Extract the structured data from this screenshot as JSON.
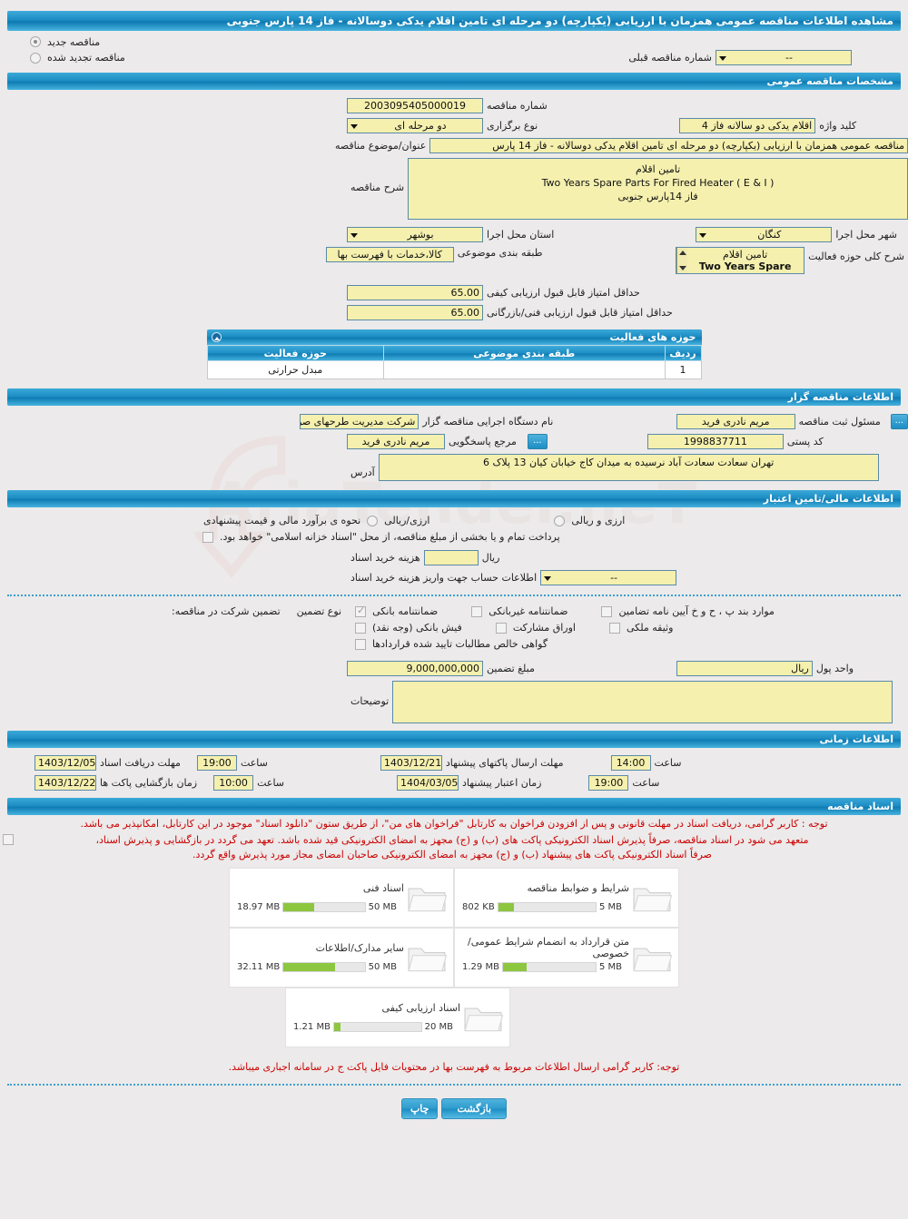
{
  "header": {
    "title": "مشاهده اطلاعات مناقصه عمومی همزمان با ارزیابی (یکپارچه) دو مرحله ای تامین اقلام یدکی دوسالانه - فاز 14 پارس جنوبی"
  },
  "top_options": {
    "new_tender_label": "مناقصه جدید",
    "renewed_tender_label": "مناقصه تجدید شده",
    "new_tender_selected": true,
    "renewed_tender_selected": false,
    "previous_number_label": "شماره مناقصه قبلی",
    "previous_number_value": "--"
  },
  "general": {
    "section_title": "مشخصات مناقصه عمومی",
    "tender_number_label": "شماره مناقصه",
    "tender_number_value": "2003095405000019",
    "holding_type_label": "نوع برگزاری",
    "holding_type_value": "دو مرحله ای",
    "keyword_label": "کلید واژه",
    "keyword_value": "اقلام یدکی دو سالانه فاز 4",
    "subject_label": "عنوان/موضوع مناقصه",
    "subject_value": "مناقصه عمومی همزمان با ارزیابی (یکپارچه) دو مرحله ای تامین اقلام یدکی دوسالانه  - فاز 14 پارس",
    "description_label": "شرح مناقصه",
    "description_line1": "تامین اقلام",
    "description_line2": "Two Years Spare Parts For Fired Heater ( E & I )",
    "description_line3": "فاز 14پارس جنوبی",
    "province_label": "استان محل اجرا",
    "province_value": "بوشهر",
    "city_label": "شهر محل اجرا",
    "city_value": "کنگان",
    "classification_label": "طبقه بندی موضوعی",
    "classification_value": "کالا،خدمات با فهرست بها",
    "activity_scope_label": "شرح کلی حوزه فعالیت",
    "activity_scope_line1": "تامین اقلام",
    "activity_scope_line2": "Two Years Spare Parts",
    "min_qualitative_label": "حداقل امتیاز قابل قبول ارزیابی کیفی",
    "min_qualitative_value": "65.00",
    "min_technical_label": "حداقل امتیاز قابل قبول ارزیابی فنی/بازرگانی",
    "min_technical_value": "65.00"
  },
  "activity_table": {
    "title": "حوزه های فعالیت",
    "columns": [
      "ردیف",
      "طبقه بندی موضوعی",
      "حوزه فعالیت"
    ],
    "rows": [
      {
        "no": "1",
        "classification": "",
        "activity": "مبدل حرارتی"
      }
    ]
  },
  "organizer": {
    "section_title": "اطلاعات مناقصه گزار",
    "executive_body_label": "نام دستگاه اجرایی مناقصه گزار",
    "executive_body_value": "شرکت مدیریت طرحهای صن",
    "registrar_label": "مسئول ثبت مناقصه",
    "registrar_value": "مریم نادری فرید",
    "contact_label": "مرجع پاسخگویی",
    "contact_value": "مریم نادری فرید",
    "postal_code_label": "کد پستی",
    "postal_code_value": "1998837711",
    "address_label": "آدرس",
    "address_value": "تهران سعادت سعادت آباد نرسیده به میدان کاج خیابان کیان 13 پلاک 6",
    "dots_label": "..."
  },
  "financial": {
    "section_title": "اطلاعات مالی/تامین اعتبار",
    "estimate_label": "نحوه ی برآورد مالی و قیمت پیشنهادی",
    "option_rial_label": "ارزی/ریالی",
    "option_rial_selected": false,
    "option_currency_rial_label": "ارزی و ریالی",
    "option_currency_rial_selected": false,
    "treasury_note": "پرداخت تمام و یا بخشی از مبلغ مناقصه، از محل \"اسناد خزانه اسلامی\" خواهد بود.",
    "treasury_checked": false,
    "doc_cost_label": "هزینه خرید اسناد",
    "doc_cost_value": "",
    "doc_cost_currency": "ریال",
    "account_info_label": "اطلاعات حساب جهت واریز هزینه خرید اسناد",
    "account_info_value": "--"
  },
  "guarantee": {
    "participation_label": "تضمین شرکت در مناقصه:",
    "type_label": "نوع تضمین",
    "options": [
      {
        "label": "ضمانتنامه بانکی",
        "checked": true
      },
      {
        "label": "ضمانتنامه غیربانکی",
        "checked": false
      },
      {
        "label": "موارد بند پ ، ح و خ آیین نامه تضامین",
        "checked": false
      },
      {
        "label": "فیش بانکی (وجه نقد)",
        "checked": false
      },
      {
        "label": "اوراق مشارکت",
        "checked": false
      },
      {
        "label": "وثیقه ملکی",
        "checked": false
      },
      {
        "label": "گواهی خالص مطالبات تایید شده قراردادها",
        "checked": false
      }
    ],
    "amount_label": "مبلغ تضمین",
    "amount_value": "9,000,000,000",
    "currency_unit_label": "واحد پول",
    "currency_unit_value": "ریال",
    "notes_label": "توضیحات",
    "notes_value": ""
  },
  "timing": {
    "section_title": "اطلاعات زمانی",
    "doc_receive_label": "مهلت دریافت اسناد",
    "doc_receive_date": "1403/12/05",
    "doc_receive_time_label": "ساعت",
    "doc_receive_time": "19:00",
    "envelope_submit_label": "مهلت ارسال پاکتهای پیشنهاد",
    "envelope_submit_date": "1403/12/21",
    "envelope_submit_time_label": "ساعت",
    "envelope_submit_time": "14:00",
    "envelope_open_label": "زمان بازگشایی پاکت ها",
    "envelope_open_date": "1403/12/22",
    "envelope_open_time_label": "ساعت",
    "envelope_open_time": "10:00",
    "proposal_validity_label": "زمان اعتبار پیشنهاد",
    "proposal_validity_date": "1404/03/05",
    "proposal_validity_time_label": "ساعت",
    "proposal_validity_time": "19:00"
  },
  "documents": {
    "section_title": "اسناد مناقصه",
    "note1": "توجه : کاربر گرامی، دریافت اسناد در مهلت قانونی و پس از افزودن فراخوان به کارتابل \"فراخوان های من\"، از طریق ستون \"دانلود اسناد\" موجود در این کارتابل، امکانپذیر می باشد.",
    "note2_line1": "متعهد می شود در اسناد مناقصه، صرفاً پذیرش اسناد الکترونیکی پاکت های (ب) و (ج) مجهز به امضای الکترونیکی قید شده باشد. تعهد می گردد در بازگشایی و پذیرش اسناد،",
    "note2_line2": "صرفاً اسناد الکترونیکی پاکت های پیشنهاد (ب) و (ج) مجهز به امضای الکترونیکی صاحبان امضای مجاز مورد پذیرش واقع گردد.",
    "note2_checked": false,
    "files": [
      {
        "name": "شرایط و ضوابط مناقصه",
        "used": "802 KB",
        "capacity": "5 MB",
        "percent": 16
      },
      {
        "name": "اسناد فنی",
        "used": "18.97 MB",
        "capacity": "50 MB",
        "percent": 38
      },
      {
        "name": "متن قرارداد به انضمام شرایط عمومی/خصوصی",
        "used": "1.29 MB",
        "capacity": "5 MB",
        "percent": 26
      },
      {
        "name": "سایر مدارک/اطلاعات",
        "used": "32.11 MB",
        "capacity": "50 MB",
        "percent": 64
      },
      {
        "name": "اسناد ارزیابی کیفی",
        "used": "1.21 MB",
        "capacity": "20 MB",
        "percent": 7
      }
    ],
    "footer_note": "توجه: کاربر گرامی ارسال اطلاعات مربوط به فهرست بها در محتویات فایل پاکت ج در سامانه اجباری میباشد."
  },
  "footer": {
    "print_label": "چاپ",
    "back_label": "بازگشت"
  },
  "watermark": {
    "text": "AriaTender.neT"
  },
  "colors": {
    "bar_blue": "#1d8ec4",
    "field_yellow": "#f5f0ae",
    "field_border": "#5a8aa8",
    "note_red": "#cc0000",
    "meter_green": "#8dc63f",
    "page_bg": "#eceaea"
  }
}
